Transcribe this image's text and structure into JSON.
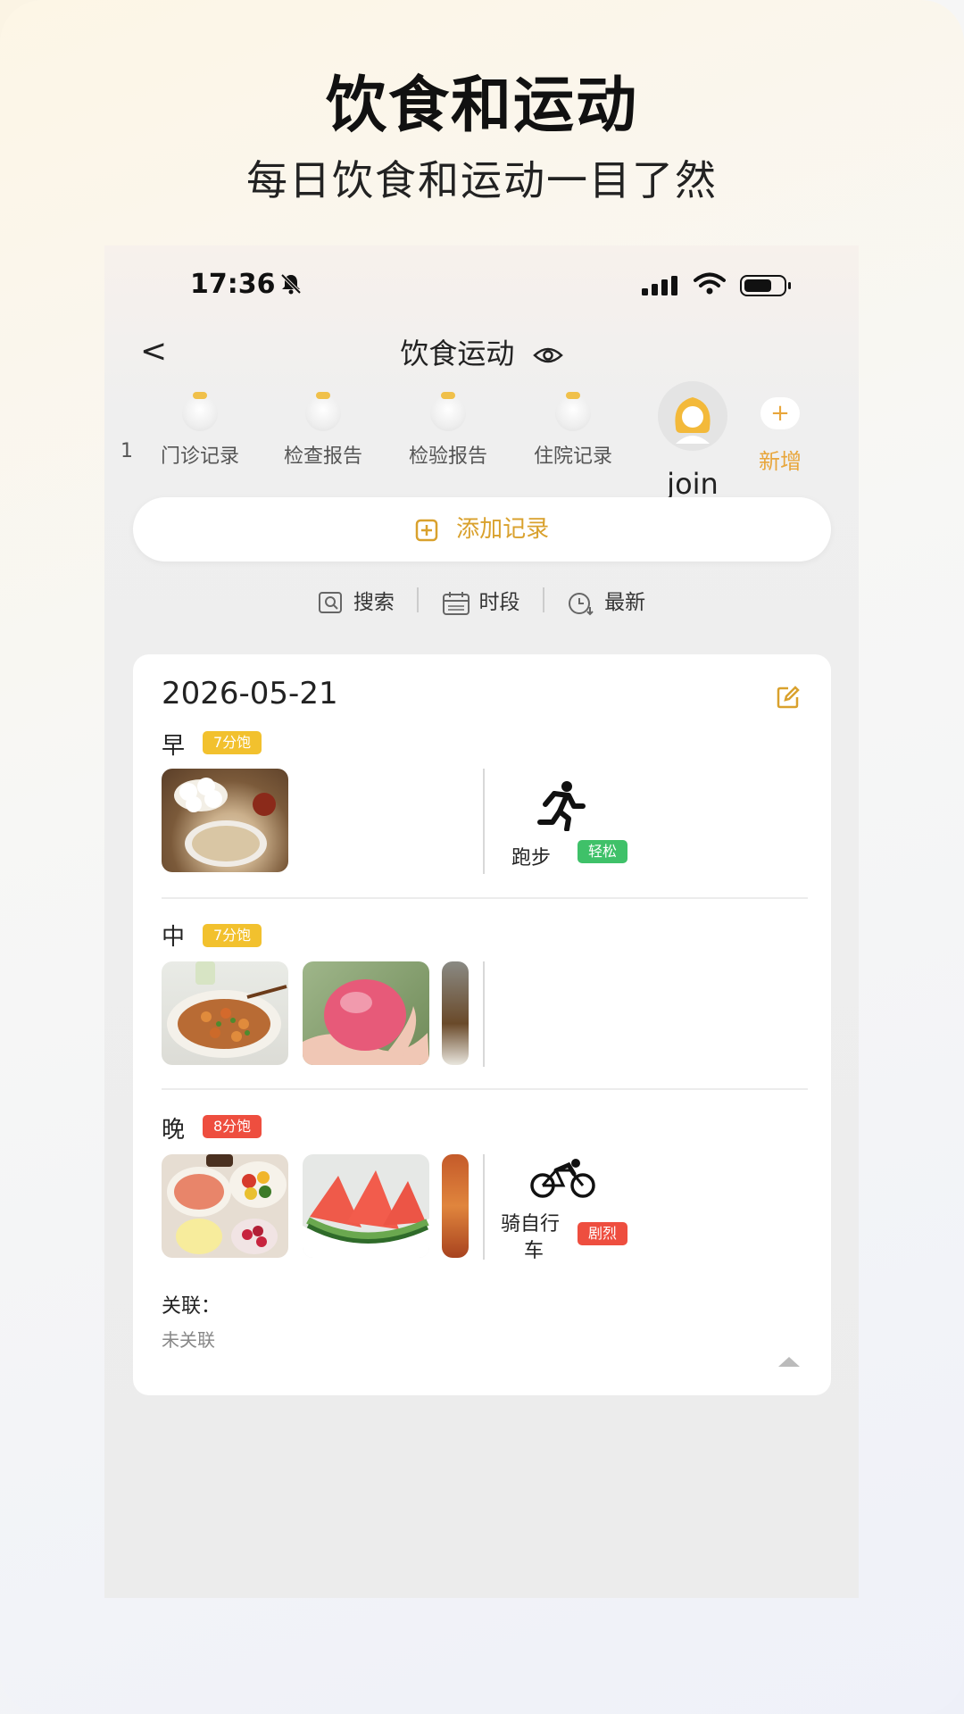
{
  "promo": {
    "title": "饮食和运动",
    "subtitle": "每日饮食和运动一目了然"
  },
  "status_bar": {
    "time": "17:36"
  },
  "nav": {
    "back_glyph": "<",
    "title": "饮食运动"
  },
  "tabs": [
    {
      "label": "门诊记录",
      "icon": "doctor-avatar-icon"
    },
    {
      "label": "检查报告",
      "icon": "doctor-avatar-icon"
    },
    {
      "label": "检验报告",
      "icon": "doctor-avatar-icon"
    },
    {
      "label": "住院记录",
      "icon": "doctor-avatar-icon"
    }
  ],
  "tab_partial_left": "1",
  "profile": {
    "name": "join"
  },
  "add_tab": {
    "icon": "+",
    "label": "新增"
  },
  "add_record": {
    "label": "添加记录"
  },
  "filters": {
    "search": "搜索",
    "period": "时段",
    "latest": "最新"
  },
  "record": {
    "date": "2026-05-21",
    "meals": [
      {
        "label": "早",
        "fullness": "7分饱",
        "fullness_color": "#f2c12e",
        "exercise": {
          "name": "跑步",
          "intensity": "轻松",
          "intensity_color": "#3fc169",
          "icon": "running-icon"
        }
      },
      {
        "label": "中",
        "fullness": "7分饱",
        "fullness_color": "#f2c12e"
      },
      {
        "label": "晚",
        "fullness": "8分饱",
        "fullness_color": "#ee4e3f",
        "exercise": {
          "name_line1": "骑自行",
          "name_line2": "车",
          "intensity": "剧烈",
          "intensity_color": "#ee4e3f",
          "icon": "cycling-icon"
        }
      }
    ],
    "association_title": "关联：",
    "association_value": "未关联"
  },
  "colors": {
    "accent": "#e8a63b",
    "badge_yellow": "#f2c12e",
    "badge_red": "#ee4e3f",
    "badge_green": "#3fc169"
  }
}
